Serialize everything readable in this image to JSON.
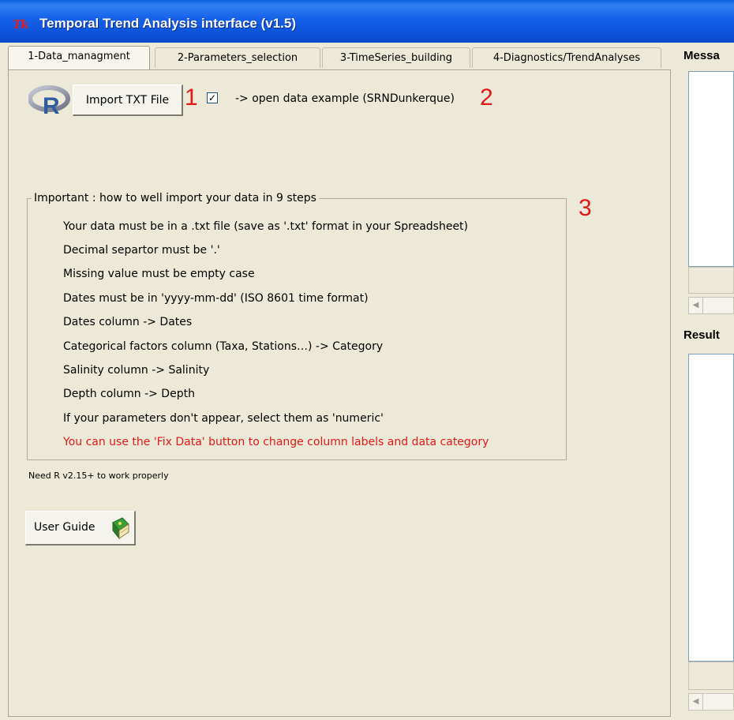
{
  "window": {
    "icon": "Tk",
    "title": "Temporal Trend Analysis interface (v1.5)"
  },
  "tabs": [
    {
      "label": "1-Data_managment"
    },
    {
      "label": "2-Parameters_selection"
    },
    {
      "label": "3-TimeSeries_building"
    },
    {
      "label": "4-Diagnostics/TrendAnalyses"
    }
  ],
  "data_tab": {
    "import_button": "Import TXT File",
    "annotation_1": "1",
    "example_checkbox_checked": true,
    "example_checkbox_mark": "✓",
    "example_label": "-> open data example (SRNDunkerque)",
    "annotation_2": "2",
    "annotation_3": "3",
    "steps_title": "Important : how to well import your data in 9 steps",
    "steps": [
      "Your data must be in a .txt file (save as '.txt' format in your Spreadsheet)",
      "Decimal separtor must be '.'",
      "Missing value must be empty case",
      "Dates must be in  'yyyy-mm-dd' (ISO 8601 time format)",
      " Dates column -> Dates",
      " Categorical factors column (Taxa, Stations…) -> Category",
      " Salinity column -> Salinity",
      " Depth column -> Depth",
      "If your parameters don't appear, select them as 'numeric'",
      "You can use the 'Fix Data' button to change column labels and data category"
    ],
    "requirement_note": "Need R v2.15+ to work properly",
    "user_guide_button": "User Guide"
  },
  "right_panel": {
    "messages_label": "Messa",
    "results_label": "Result"
  },
  "icons": {
    "r_logo": "r-logo-icon",
    "book": "book-icon",
    "scroll_left": "◀"
  },
  "colors": {
    "title_bar": "#0b52d8",
    "annotation_red": "#e01818",
    "window_bg": "#ece9d8"
  }
}
